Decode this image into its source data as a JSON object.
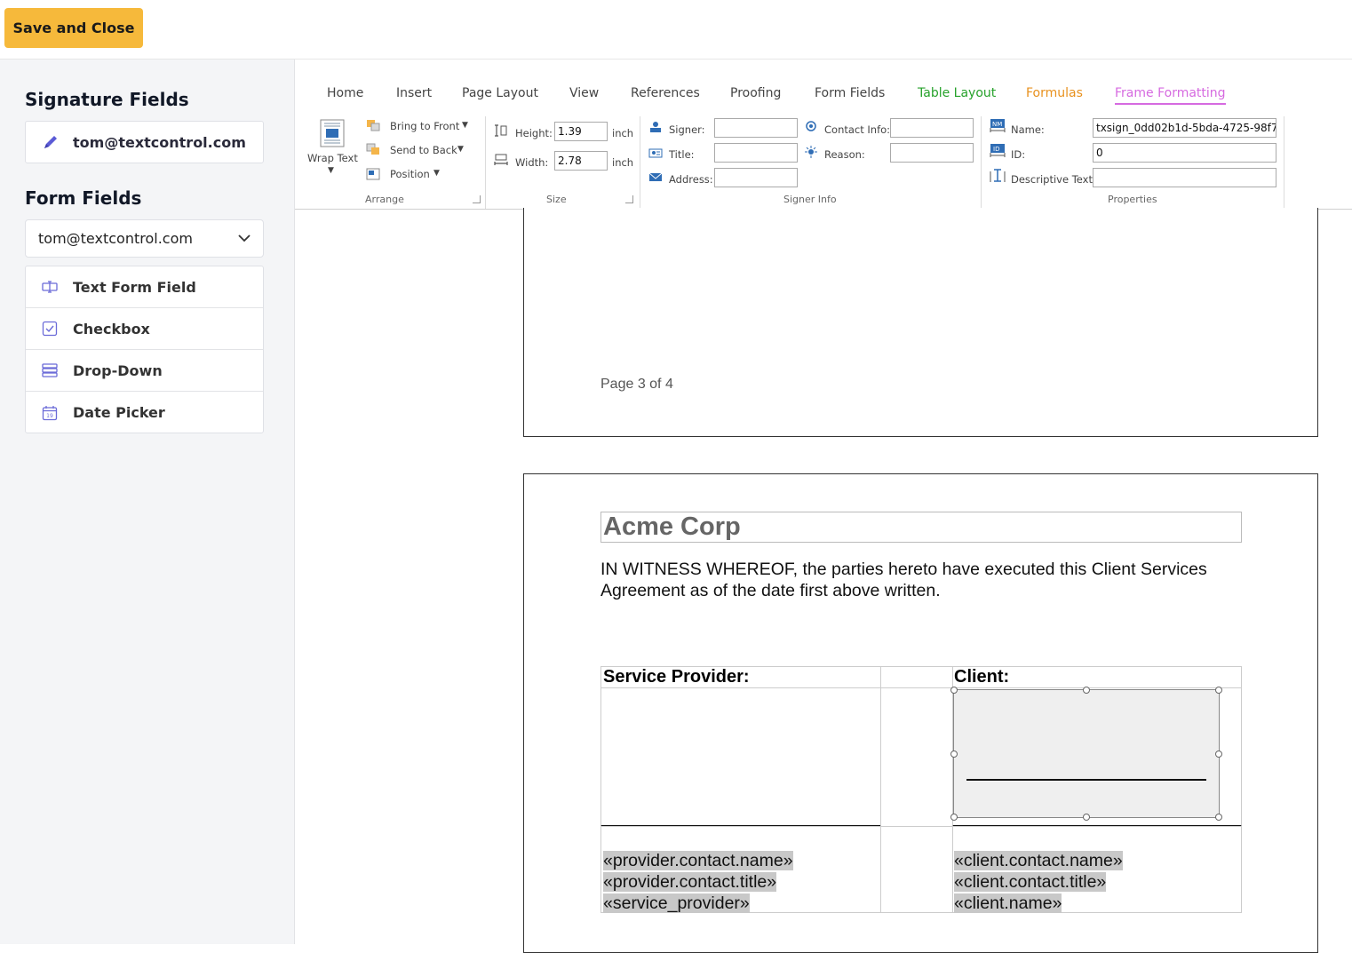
{
  "toolbar": {
    "save_label": "Save and Close"
  },
  "sidebar": {
    "signature_heading": "Signature Fields",
    "signature_user": "tom@textcontrol.com",
    "form_heading": "Form Fields",
    "user_select_value": "tom@textcontrol.com",
    "fields": [
      {
        "label": "Text Form Field",
        "icon": "text-field-icon"
      },
      {
        "label": "Checkbox",
        "icon": "checkbox-icon"
      },
      {
        "label": "Drop-Down",
        "icon": "dropdown-icon"
      },
      {
        "label": "Date Picker",
        "icon": "calendar-icon"
      }
    ]
  },
  "ribbon": {
    "tabs": [
      "Home",
      "Insert",
      "Page Layout",
      "View",
      "References",
      "Proofing",
      "Form Fields",
      "Table Layout",
      "Formulas",
      "Frame Formatting"
    ],
    "active_tab": "Frame Formatting",
    "arrange": {
      "wrap_text": "Wrap Text",
      "bring_to_front": "Bring to Front",
      "send_to_back": "Send to Back",
      "position": "Position",
      "label": "Arrange"
    },
    "size": {
      "height_label": "Height:",
      "height_value": "1.39",
      "width_label": "Width:",
      "width_value": "2.78",
      "unit": "inch",
      "label": "Size"
    },
    "signer_info": {
      "signer": "Signer:",
      "title": "Title:",
      "address": "Address:",
      "contact_info": "Contact Info:",
      "reason": "Reason:",
      "label": "Signer Info"
    },
    "properties": {
      "name_label": "Name:",
      "name_value": "txsign_0dd02b1d-5bda-4725-98f7",
      "id_label": "ID:",
      "id_value": "0",
      "desc_label": "Descriptive Text:",
      "label": "Properties"
    }
  },
  "document": {
    "page_footer": "Page 3 of 4",
    "title": "Acme Corp",
    "witness_text": "IN WITNESS WHEREOF, the parties hereto have executed this Client Services Agreement as of the date first above written.",
    "provider_header": "Service Provider:",
    "client_header": "Client:",
    "provider_fields": [
      "«provider.contact.name»",
      "«provider.contact.title»",
      "«service_provider»"
    ],
    "client_fields": [
      "«client.contact.name»",
      "«client.contact.title»",
      "«client.name»"
    ]
  }
}
